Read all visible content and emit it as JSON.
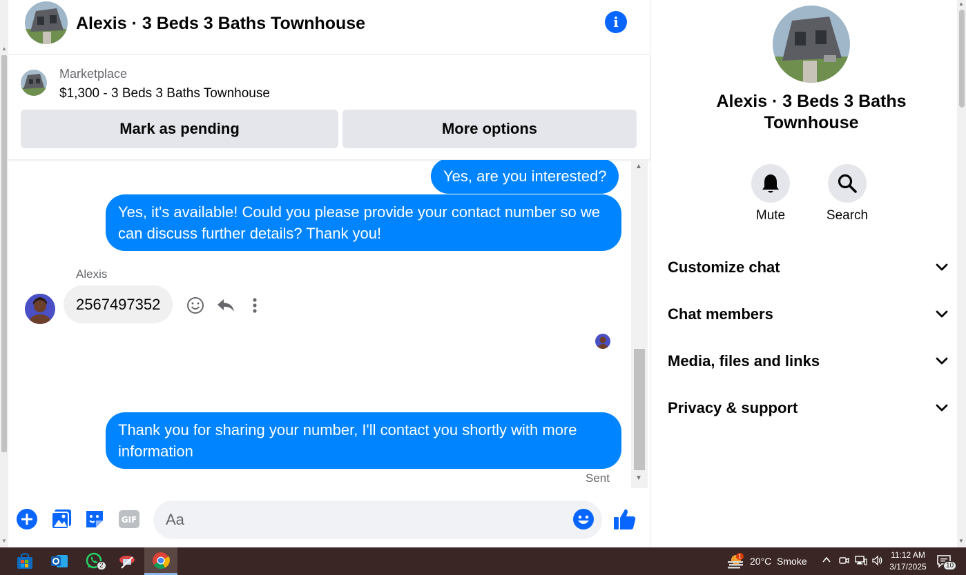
{
  "chat": {
    "title": "Alexis · 3 Beds 3 Baths Townhouse",
    "marketplace_label": "Marketplace",
    "listing_title": "$1,300 - 3 Beds 3 Baths Townhouse",
    "mark_pending_label": "Mark as pending",
    "more_options_label": "More options",
    "messages": {
      "out1": "Yes, are you interested?",
      "out2": "Yes, it's available! Could you please provide your contact number so we can discuss further details? Thank you!",
      "sender_name": "Alexis",
      "in1": "2567497352",
      "out3": "Thank you for sharing your number, I'll contact you shortly with more information",
      "sent_status": "Sent"
    },
    "composer_placeholder": "Aa"
  },
  "panel": {
    "title": "Alexis · 3 Beds 3 Baths Townhouse",
    "mute_label": "Mute",
    "search_label": "Search",
    "sections": [
      "Customize chat",
      "Chat members",
      "Media, files and links",
      "Privacy & support"
    ]
  },
  "taskbar": {
    "whatsapp_badge": "2",
    "weather_badge": "1",
    "weather": "20°C  Smoke",
    "time": "11:12 AM",
    "date": "3/17/2025",
    "notifications": "10"
  },
  "colors": {
    "accent": "#0084ff",
    "info": "#0866ff",
    "bubble_in": "#f0f0f0",
    "button_gray": "#e4e6eb",
    "taskbar": "#3a2624"
  }
}
